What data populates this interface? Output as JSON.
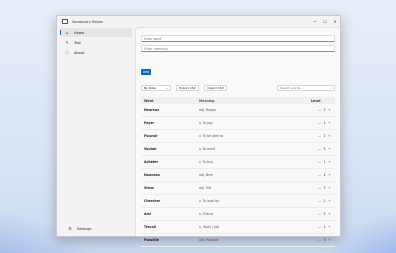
{
  "window": {
    "title": "Vocabulary Helper"
  },
  "window_controls": {
    "minimize": "—",
    "maximize": "☐",
    "close": "✕"
  },
  "sidebar": {
    "items": [
      {
        "label": "Home",
        "icon": "home-icon",
        "glyph": "⌂"
      },
      {
        "label": "Test",
        "icon": "edit-icon",
        "glyph": "✎"
      },
      {
        "label": "About",
        "icon": "info-icon",
        "glyph": "ⓘ"
      }
    ],
    "settings": {
      "label": "Settings",
      "icon": "gear-icon",
      "glyph": "⚙"
    }
  },
  "form": {
    "word_placeholder": "Enter word",
    "meaning_placeholder": "Enter meaning",
    "add_label": "Add"
  },
  "toolbar": {
    "sort_value": "By Date",
    "sort_chevron": "⌄",
    "export_label": "Export CSV",
    "import_label": "Import CSV",
    "search_placeholder": "Search words...",
    "search_glyph": "⌕"
  },
  "table": {
    "headers": {
      "word": "Word",
      "meaning": "Meaning",
      "level": "Level"
    },
    "decrement": "—",
    "increment": "+",
    "rows": [
      {
        "word": "Heureux",
        "meaning": "adj. Happy",
        "level": "3"
      },
      {
        "word": "Payer",
        "meaning": "v. To pay",
        "level": "1"
      },
      {
        "word": "Pouvoir",
        "meaning": "v. To be able to",
        "level": "2"
      },
      {
        "word": "Vouloir",
        "meaning": "v. To want",
        "level": "5"
      },
      {
        "word": "Acheter",
        "meaning": "v. To buy",
        "level": "1"
      },
      {
        "word": "Nouveau",
        "meaning": "adj. New",
        "level": "4"
      },
      {
        "word": "Vieux",
        "meaning": "adj. Old",
        "level": "3"
      },
      {
        "word": "Chercher",
        "meaning": "v. To look for",
        "level": "2"
      },
      {
        "word": "Ami",
        "meaning": "n. Friend",
        "level": "5"
      },
      {
        "word": "Travail",
        "meaning": "n. Work / Job",
        "level": "1"
      },
      {
        "word": "Possible",
        "meaning": "adj. Possible",
        "level": "3"
      }
    ]
  }
}
